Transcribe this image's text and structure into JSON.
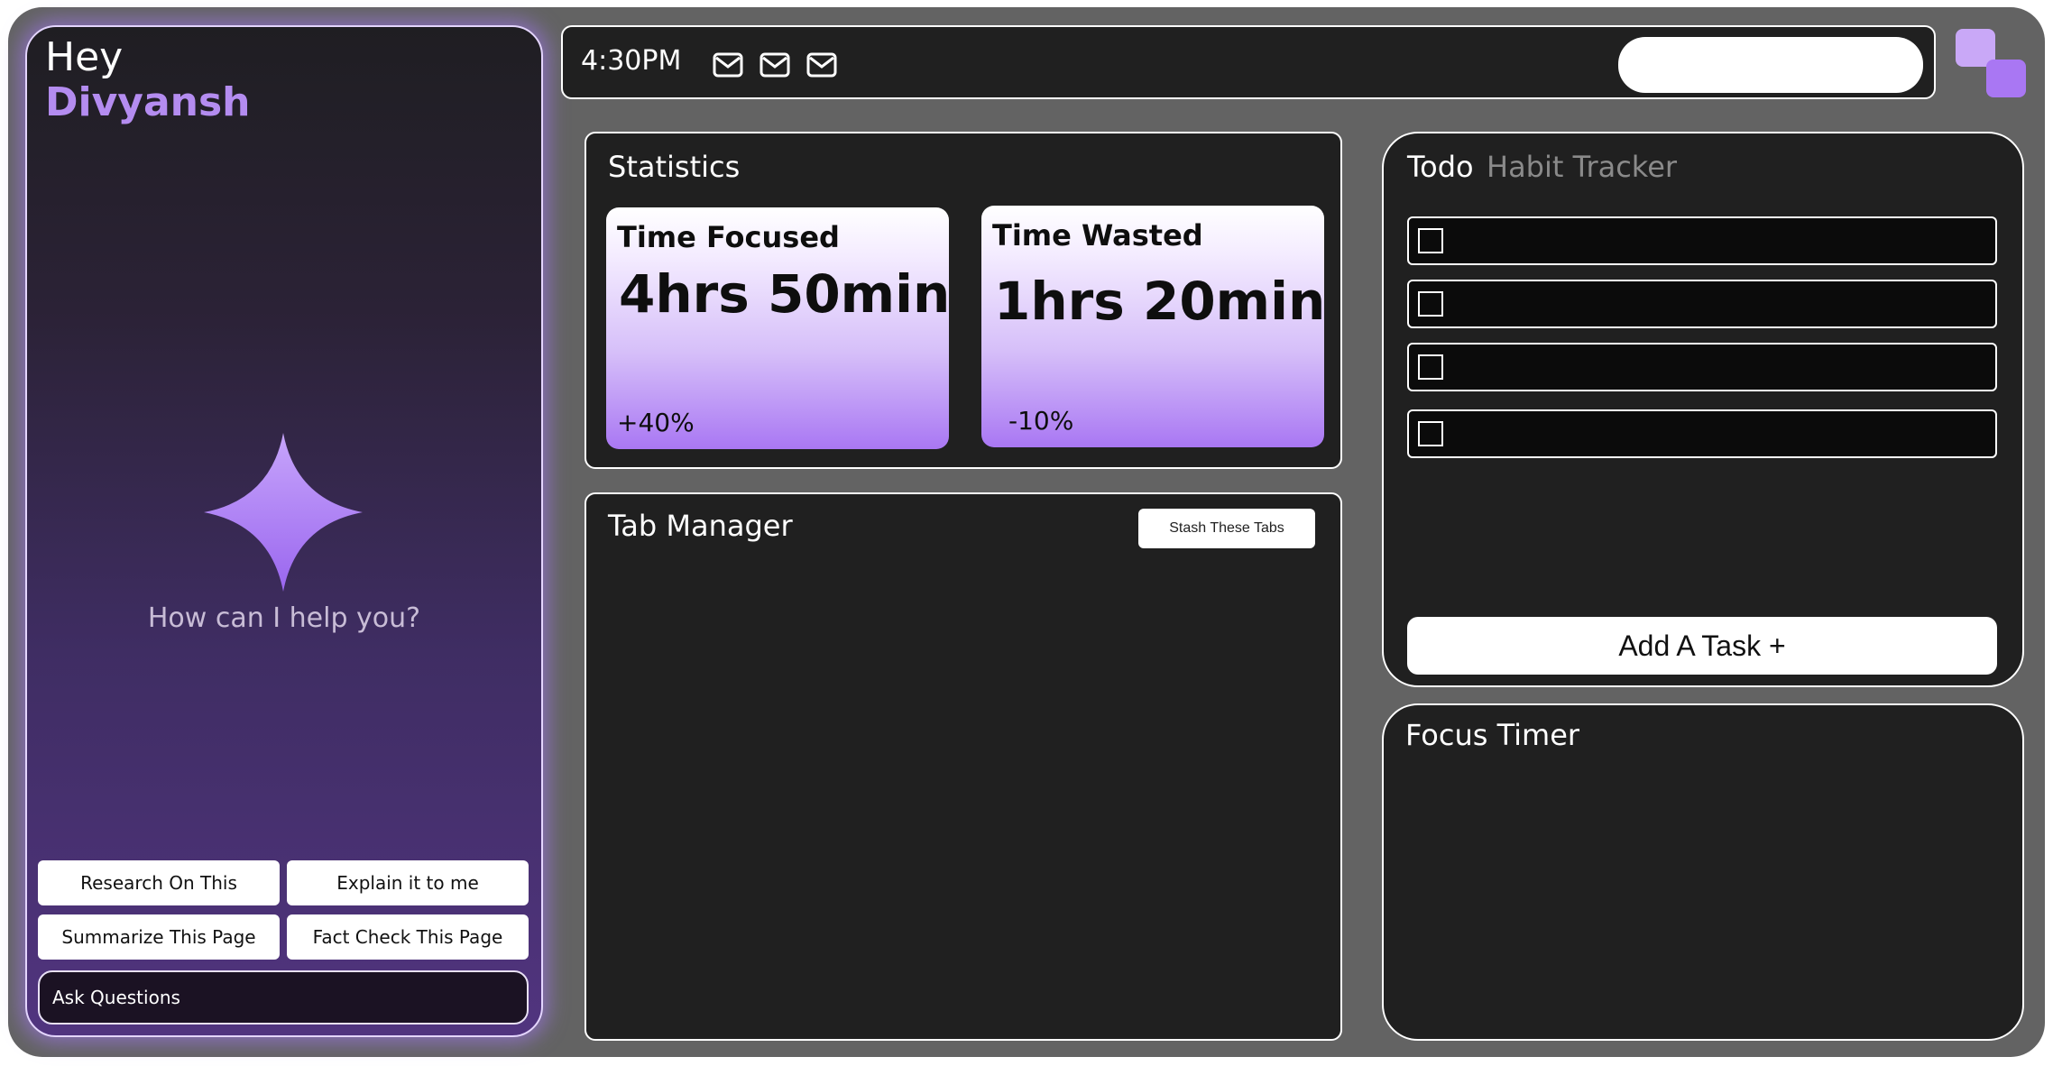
{
  "assistant": {
    "greeting": "Hey",
    "user_name": "Divyansh",
    "prompt": "How can I help you?",
    "actions": [
      "Research On This",
      "Explain it to me",
      "Summarize This Page",
      "Fact Check This Page"
    ],
    "input_placeholder": "Ask Questions"
  },
  "topbar": {
    "time": "4:30PM",
    "icons": [
      "mail-icon",
      "mail-icon",
      "mail-icon"
    ],
    "search_value": ""
  },
  "statistics": {
    "title": "Statistics",
    "cards": [
      {
        "label": "Time Focused",
        "value": "4hrs 50min",
        "delta": "+40%"
      },
      {
        "label": "Time Wasted",
        "value": "1hrs 20min",
        "delta": "-10%"
      }
    ]
  },
  "tab_manager": {
    "title": "Tab Manager",
    "stash_label": "Stash These Tabs"
  },
  "todo": {
    "tabs": [
      {
        "label": "Todo",
        "active": true
      },
      {
        "label": "Habit Tracker",
        "active": false
      }
    ],
    "tasks": [
      "",
      "",
      "",
      ""
    ],
    "add_label": "Add A Task +"
  },
  "focus_timer": {
    "title": "Focus Timer"
  },
  "colors": {
    "accent": "#a977f3",
    "accent_light": "#b48cf0",
    "panel_bg": "#202020",
    "frame_bg": "#636363",
    "inactive_tab": "#8a8a8a"
  }
}
